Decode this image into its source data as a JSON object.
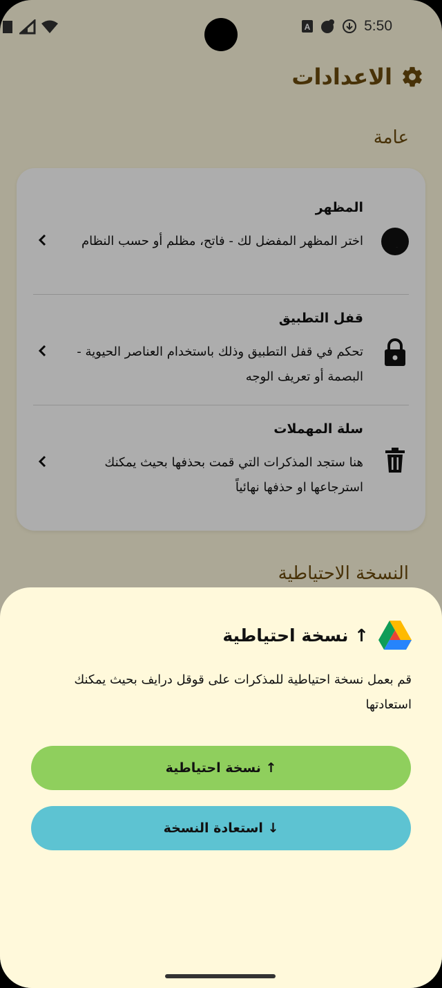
{
  "status_bar": {
    "time": "5:50",
    "icons": [
      "signal-icon",
      "wifi-icon",
      "a-badge-icon",
      "notification-icon",
      "data-saver-icon"
    ]
  },
  "header": {
    "title": "الاعدادات",
    "icon": "gear-icon"
  },
  "sections": {
    "general": "عامة",
    "backup": "النسخة الاحتياطية"
  },
  "settings": [
    {
      "title": "المظهر",
      "description": "اختر المظهر المفضل لك - فاتح، مظلم أو حسب النظام",
      "icon": "moon-icon"
    },
    {
      "title": "قفل التطبيق",
      "description": "تحكم في قفل التطبيق وذلك باستخدام العناصر الحيوية - البصمة أو تعريف الوجه",
      "icon": "lock-icon"
    },
    {
      "title": "سلة المهملات",
      "description": "هنا ستجد المذكرات التي قمت بحذفها بحيث يمكنك استرجاعها او حذفها نهائياً",
      "icon": "trash-icon"
    }
  ],
  "sheet": {
    "title": "↑ نسخة احتياطية",
    "description": "قم بعمل نسخة احتياطية للمذكرات على قوقل درايف بحيث يمكنك استعادتها",
    "backup_button": "↑ نسخة احتياطية",
    "restore_button": "↓ استعادة النسخة"
  },
  "colors": {
    "background": "#FEF8DD",
    "accent": "#6b4a0c",
    "backup_button": "#8FCF5D",
    "restore_button": "#5DC3D2"
  }
}
